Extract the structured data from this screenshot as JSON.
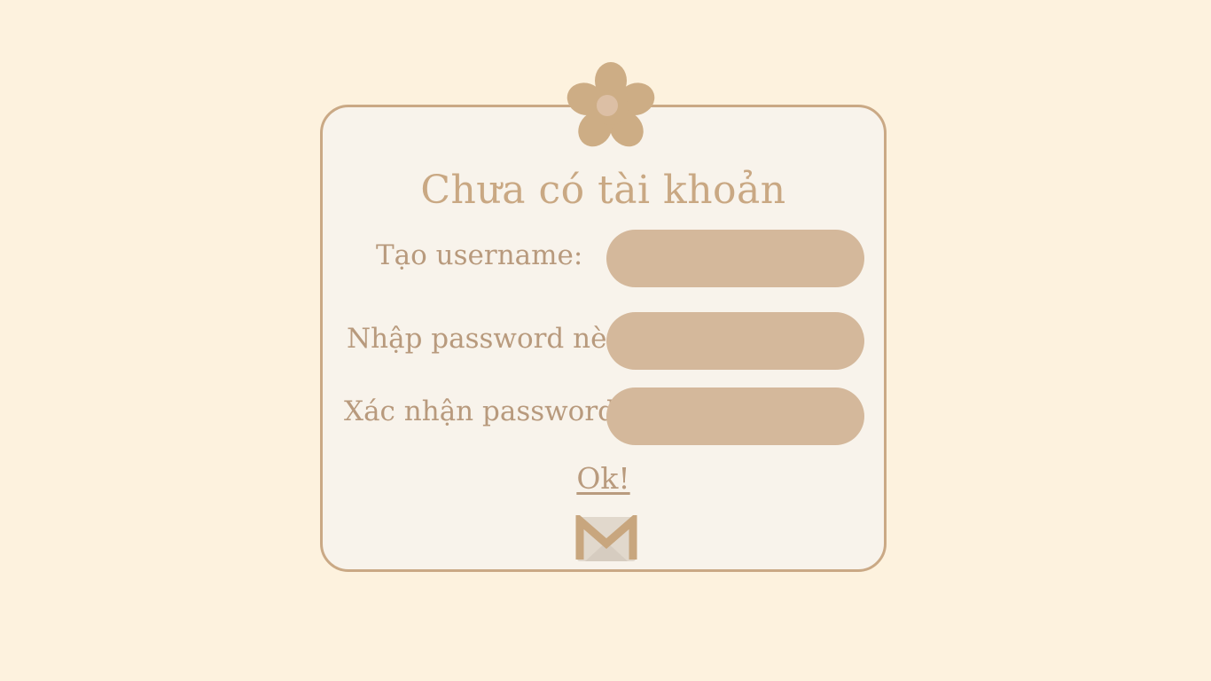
{
  "signup": {
    "title": "Chưa có tài khoản",
    "username_label": "Tạo username:",
    "password_label": "Nhập password nè:",
    "confirm_label": "Xác nhận password:",
    "username_value": "",
    "password_value": "",
    "confirm_value": "",
    "submit_label": "Ok!",
    "mail_icon": "gmail-icon",
    "flower_icon": "flower-icon"
  },
  "colors": {
    "background": "#fdf2de",
    "card": "#f8f3eb",
    "border": "#caa985",
    "field": "#d4b89b",
    "text": "#b89a7d",
    "title": "#c9a883"
  }
}
